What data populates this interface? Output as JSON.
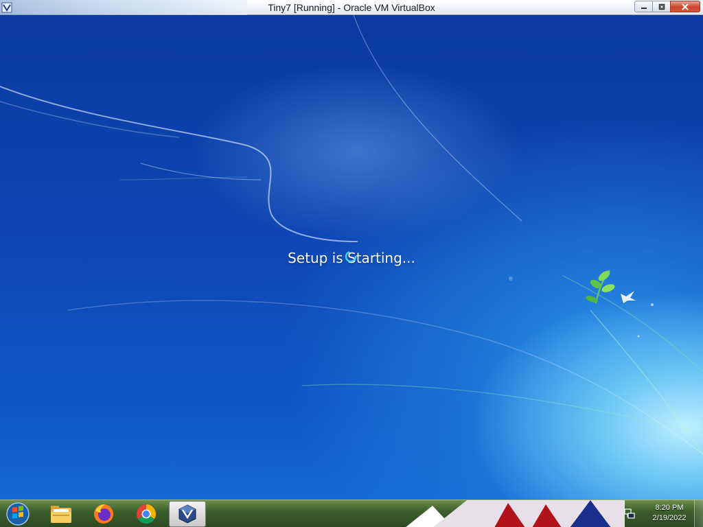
{
  "window": {
    "title": "Tiny7 [Running] - Oracle VM VirtualBox",
    "icon": "virtualbox-icon",
    "buttons": [
      "minimize-icon",
      "restore-icon",
      "close-icon"
    ]
  },
  "vm_screen": {
    "status_text": "Setup is Starting...",
    "spinner": "loading-spinner-icon"
  },
  "taskbar": {
    "start_icon": "windows-start-orb",
    "pinned": [
      {
        "name": "windows-explorer",
        "icon": "folder-icon"
      },
      {
        "name": "firefox",
        "icon": "firefox-icon"
      },
      {
        "name": "chrome",
        "icon": "chrome-icon"
      },
      {
        "name": "virtualbox",
        "icon": "virtualbox-icon",
        "active": true
      }
    ],
    "tray": {
      "network_icon": "network-icon",
      "time": "8:20 PM",
      "date": "2/19/2022"
    }
  },
  "colors": {
    "desktop_blue": "#0d46b4",
    "close_red": "#c8432b",
    "taskbar_green": "#3d5f2c"
  }
}
